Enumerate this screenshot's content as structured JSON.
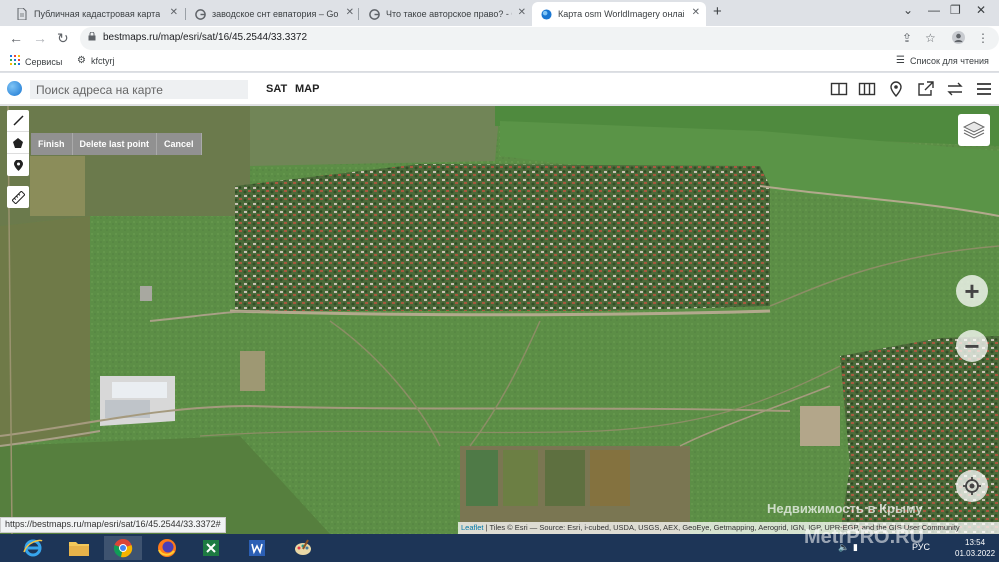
{
  "tabs": [
    {
      "label": "Публичная кадастровая карта -",
      "icon": "doc-icon"
    },
    {
      "label": "заводское снт евпатория – Goo",
      "icon": "google-icon"
    },
    {
      "label": "Что такое авторское право? - G",
      "icon": "google-icon"
    },
    {
      "label": "Карта osm WorldImagery онлай",
      "icon": "globe-icon"
    }
  ],
  "address_bar": {
    "url": "bestmaps.ru/map/esri/sat/16/45.2544/33.3372"
  },
  "bookmarks": [
    {
      "label": "Сервисы"
    },
    {
      "label": "kfctyrj"
    }
  ],
  "reading_list": "Список для чтения",
  "map_header": {
    "search_placeholder": "Поиск адреса на карте",
    "sat": "SAT",
    "map": "MAP"
  },
  "draw_actions": {
    "finish": "Finish",
    "delete_last": "Delete last point",
    "cancel": "Cancel"
  },
  "zoom": {
    "in": "+",
    "out": "−"
  },
  "attribution": {
    "leaflet": "Leaflet",
    "text": " | Tiles © Esri — Source: Esri, i-cubed, USDA, USGS, AEX, GeoEye, Getmapping, Aerogrid, IGN, IGP, UPR-EGP, and the GIS User Community"
  },
  "status_url": "https://bestmaps.ru/map/esri/sat/16/45.2544/33.3372#",
  "watermark": {
    "line1": "Недвижимость в Крыму",
    "line2": "MetrPRO.RU"
  },
  "tray": {
    "lang": "РУС",
    "time": "13:54",
    "date": "01.03.2022"
  },
  "colors": {
    "accent": "#1a73e8",
    "taskbar": "#1d3557",
    "draw_actions_bg": "#919191"
  }
}
